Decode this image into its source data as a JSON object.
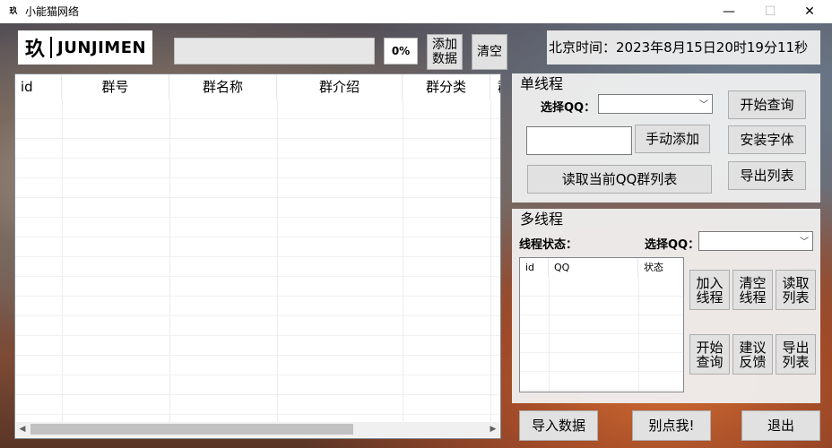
{
  "window": {
    "title": "小能猫网络",
    "app_icon": "玖",
    "minimize": "—",
    "maximize": "☐",
    "close": "✕"
  },
  "logo": {
    "mark": "玖",
    "word": "JUNJIMEN"
  },
  "toolbar": {
    "progress_percent": "0%",
    "progress_value": 0,
    "add_data": [
      "添加",
      "数据"
    ],
    "clear": "清空"
  },
  "time": {
    "text": "北京时间：2023年8月15日20时19分11秒"
  },
  "main_table": {
    "columns": [
      "id",
      "群号",
      "群名称",
      "群介绍",
      "群分类",
      "群"
    ]
  },
  "single": {
    "title": "单线程",
    "select_qq_label": "选择QQ：",
    "select_qq_value": "",
    "manual_add": "手动添加",
    "read_groups": "读取当前QQ群列表",
    "start_query": "开始查询",
    "install_font": "安装字体",
    "export_list": "导出列表"
  },
  "multi": {
    "title": "多线程",
    "status_label": "线程状态：",
    "select_qq_label": "选择QQ：",
    "table_columns": [
      "id",
      "QQ",
      "状态"
    ],
    "add_thread": [
      "加入",
      "线程"
    ],
    "clear_thread": [
      "清空",
      "线程"
    ],
    "read_list": [
      "读取",
      "列表"
    ],
    "start_query": [
      "开始",
      "查询"
    ],
    "feedback": [
      "建议",
      "反馈"
    ],
    "export_list": [
      "导出",
      "列表"
    ]
  },
  "bottom": {
    "import": "导入数据",
    "dont_click": "别点我!",
    "exit": "退出"
  }
}
